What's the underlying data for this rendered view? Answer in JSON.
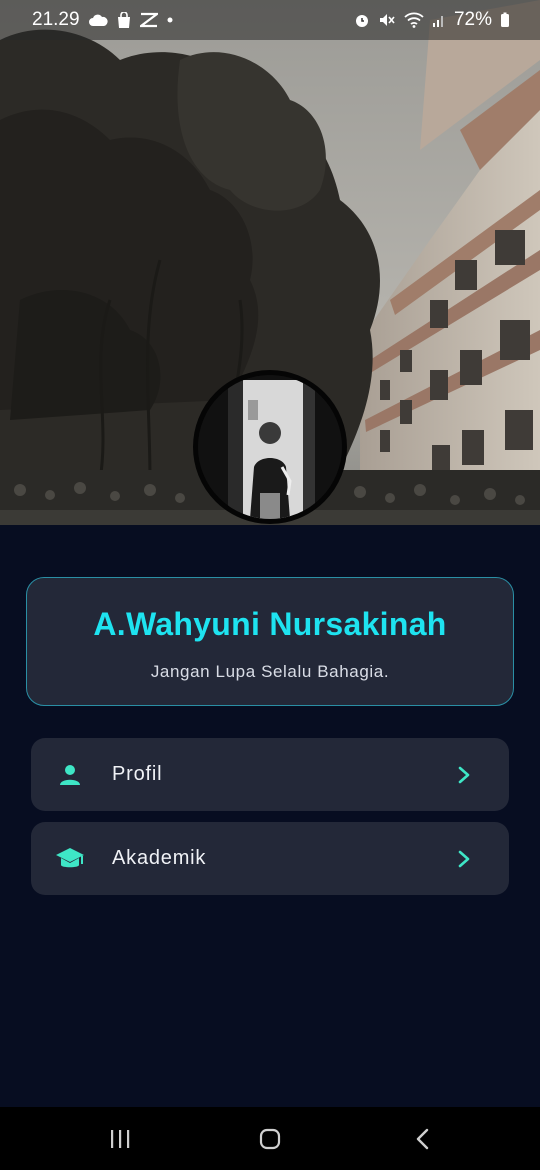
{
  "status_bar": {
    "time": "21.29",
    "battery_percent": "72%",
    "left_icons": [
      "cloud-icon",
      "shopping-bag-icon",
      "capcut-icon",
      "dot-icon"
    ],
    "right_icons": [
      "alarm-icon",
      "mute-icon",
      "wifi-icon",
      "signal-icon",
      "battery-icon"
    ]
  },
  "profile": {
    "name": "A.Wahyuni Nursakinah",
    "tagline": "Jangan Lupa Selalu Bahagia."
  },
  "menu": [
    {
      "label": "Profil",
      "icon": "person-icon"
    },
    {
      "label": "Akademik",
      "icon": "graduation-cap-icon"
    }
  ],
  "nav_bar": [
    "recent-apps-icon",
    "home-icon",
    "back-icon"
  ],
  "colors": {
    "background": "#070d21",
    "card": "#232838",
    "accent_cyan": "#1ee3f0",
    "icon_teal": "#3ee6c6",
    "card_border": "#2a8fa5"
  }
}
